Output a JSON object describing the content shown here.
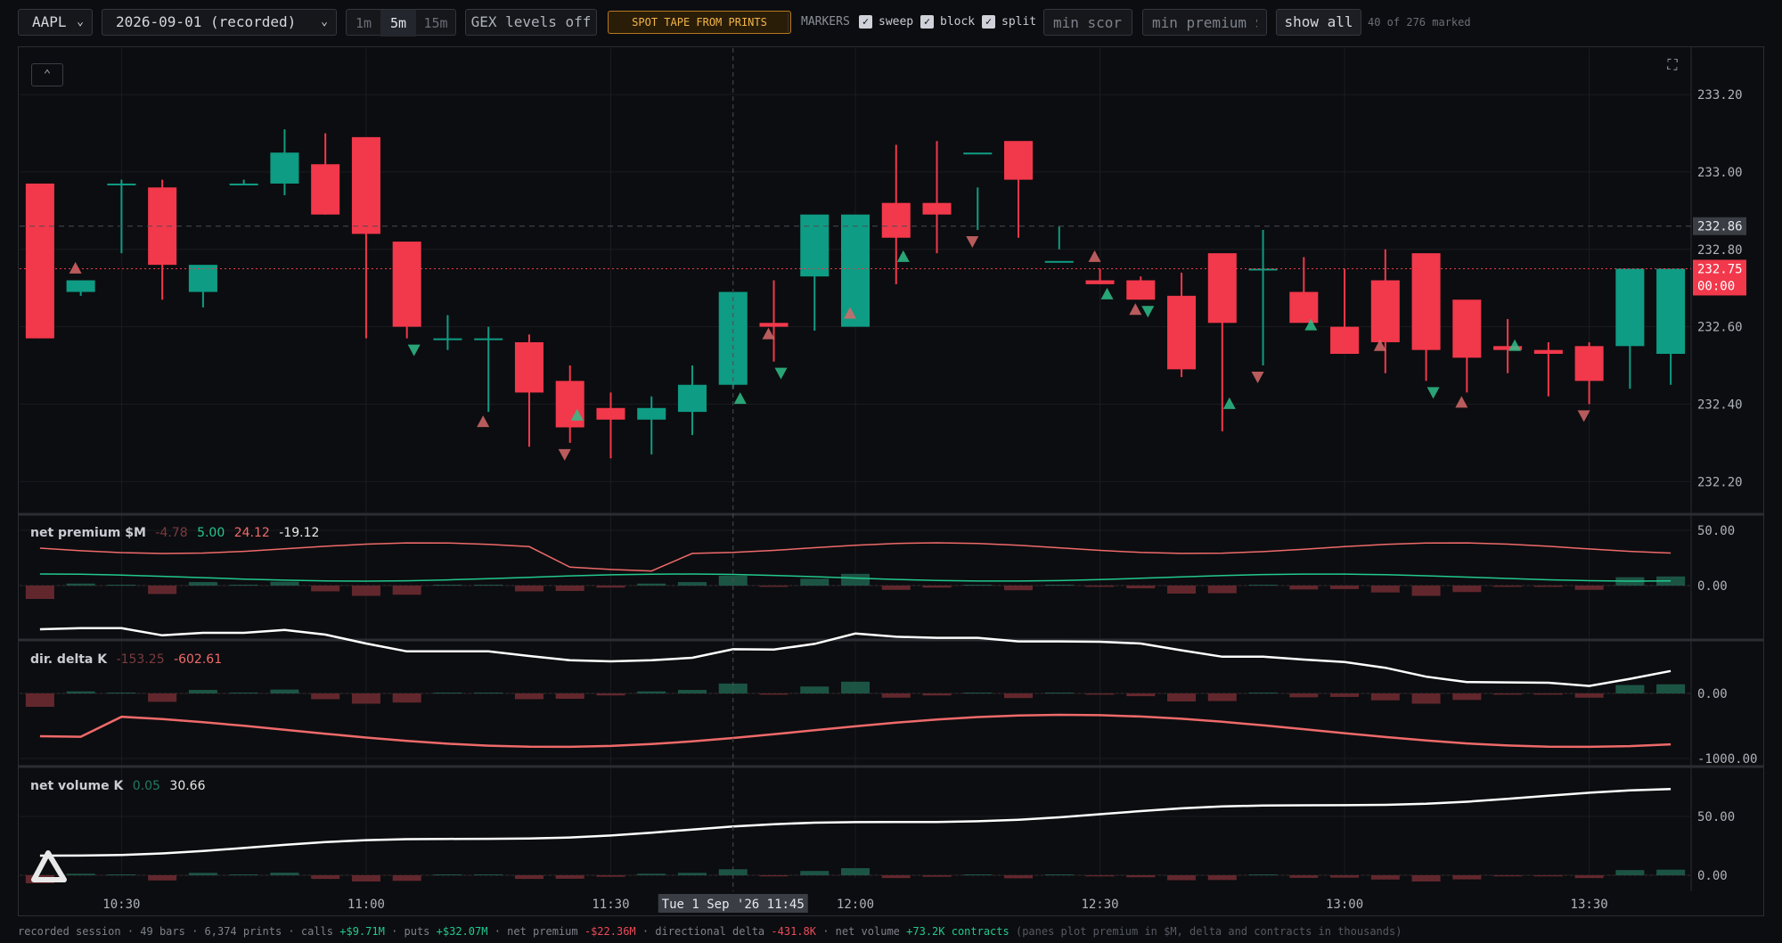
{
  "toolbar": {
    "symbol": "AAPL",
    "date": "2026-09-01 (recorded)",
    "timeframes": [
      "1m",
      "5m",
      "15m"
    ],
    "active_timeframe": "5m",
    "gex_button": "GEX levels off",
    "spot_button": "SPOT TAPE FROM PRINTS",
    "markers_label": "MARKERS",
    "marker_toggles": [
      {
        "label": "sweep",
        "checked": true
      },
      {
        "label": "block",
        "checked": true
      },
      {
        "label": "split",
        "checked": true
      }
    ],
    "min_score_placeholder": "min score",
    "min_premium_placeholder": "min premium $",
    "show_all": "show all",
    "marked_count": "40 of 276 marked"
  },
  "colors": {
    "up": "#0f9c84",
    "down": "#f2384b",
    "accent": "#f2b54a",
    "premium_line": "#ffffff",
    "calls_line": "#22c98e",
    "puts_line": "#ef6a6a"
  },
  "price_axis": {
    "ticks": [
      "233.20",
      "233.00",
      "232.80",
      "232.60",
      "232.40",
      "232.20"
    ],
    "crosshair_price": "232.86",
    "last_price": "232.75",
    "countdown": "00:00"
  },
  "time_axis": {
    "ticks": [
      "10:30",
      "11:00",
      "11:30",
      "12:00",
      "12:30",
      "13:00",
      "13:30"
    ],
    "crosshair_label": "Tue 1 Sep '26 11:45"
  },
  "panes": {
    "premium": {
      "title": "net premium $M",
      "v1": "-4.78",
      "v2": "5.00",
      "v3": "24.12",
      "v4": "-19.12",
      "ticks": [
        "50.00",
        "0.00"
      ]
    },
    "delta": {
      "title": "dir. delta K",
      "v1": "-153.25",
      "v2": "-602.61",
      "ticks": [
        "0.00",
        "-1000.00"
      ]
    },
    "volume": {
      "title": "net volume K",
      "v1": "0.05",
      "v2": "30.66",
      "ticks": [
        "50.00",
        "0.00"
      ]
    }
  },
  "chart_data": {
    "type": "candlestick",
    "symbol": "AAPL",
    "interval": "5m",
    "x": [
      "10:20",
      "10:25",
      "10:30",
      "10:35",
      "10:40",
      "10:45",
      "10:50",
      "10:55",
      "11:00",
      "11:05",
      "11:10",
      "11:15",
      "11:20",
      "11:25",
      "11:30",
      "11:35",
      "11:40",
      "11:45",
      "11:50",
      "11:55",
      "12:00",
      "12:05",
      "12:10",
      "12:15",
      "12:20",
      "12:25",
      "12:30",
      "12:35",
      "12:40",
      "12:45",
      "12:50",
      "12:55",
      "13:00",
      "13:05",
      "13:10",
      "13:15",
      "13:20",
      "13:25",
      "13:30"
    ],
    "open": [
      232.97,
      232.69,
      232.97,
      232.96,
      232.69,
      232.97,
      232.97,
      233.02,
      233.09,
      232.82,
      232.57,
      232.57,
      232.56,
      232.46,
      232.39,
      232.36,
      232.38,
      232.45,
      232.61,
      232.73,
      232.6,
      232.92,
      232.92,
      233.05,
      233.08,
      232.77,
      232.72,
      232.72,
      232.68,
      232.79,
      232.75,
      232.69,
      232.6,
      232.72,
      232.79,
      232.67,
      232.55,
      232.54,
      232.55,
      232.55,
      232.53,
      232.53,
      232.47,
      232.75
    ],
    "high": [
      232.97,
      232.7,
      232.98,
      232.98,
      232.72,
      232.98,
      233.11,
      233.1,
      232.93,
      232.6,
      232.63,
      232.6,
      232.58,
      232.5,
      232.43,
      232.42,
      232.5,
      232.62,
      232.72,
      232.79,
      232.77,
      233.07,
      233.08,
      232.96,
      233.04,
      232.86,
      232.75,
      232.73,
      232.74,
      232.73,
      232.85,
      232.78,
      232.75,
      232.8,
      232.77,
      232.58,
      232.62,
      232.56,
      232.56,
      232.61,
      232.57,
      232.75,
      232.75
    ],
    "low": [
      232.57,
      232.68,
      232.79,
      232.67,
      232.65,
      232.97,
      232.94,
      232.89,
      232.57,
      232.57,
      232.54,
      232.38,
      232.29,
      232.3,
      232.26,
      232.27,
      232.32,
      232.44,
      232.51,
      232.59,
      232.66,
      232.71,
      232.79,
      232.85,
      232.83,
      232.8,
      232.71,
      232.67,
      232.47,
      232.33,
      232.5,
      232.63,
      232.54,
      232.48,
      232.46,
      232.43,
      232.48,
      232.42,
      232.4,
      232.44,
      232.45,
      232.44,
      232.57
    ],
    "close": [
      232.57,
      232.72,
      232.97,
      232.76,
      232.76,
      232.97,
      233.05,
      232.89,
      232.84,
      232.6,
      232.57,
      232.57,
      232.43,
      232.34,
      232.36,
      232.39,
      232.45,
      232.69,
      232.6,
      232.89,
      232.89,
      232.83,
      232.89,
      233.05,
      232.98,
      232.77,
      232.71,
      232.67,
      232.49,
      232.61,
      232.75,
      232.61,
      232.53,
      232.56,
      232.54,
      232.52,
      232.54,
      232.53,
      232.46,
      232.75,
      232.75
    ]
  },
  "status": {
    "prefix": "recorded session · 49 bars · 6,374 prints · calls",
    "calls": "+$9.71M",
    "puts_label": "· puts",
    "puts": "+$32.07M",
    "premium_label": "· net premium",
    "premium": "-$22.36M",
    "delta_label": "· directional delta",
    "delta": "-431.8K",
    "volume_label": "· net volume",
    "volume": "+73.2K contracts",
    "note": "(panes plot premium in $M, delta and contracts in thousands)"
  }
}
